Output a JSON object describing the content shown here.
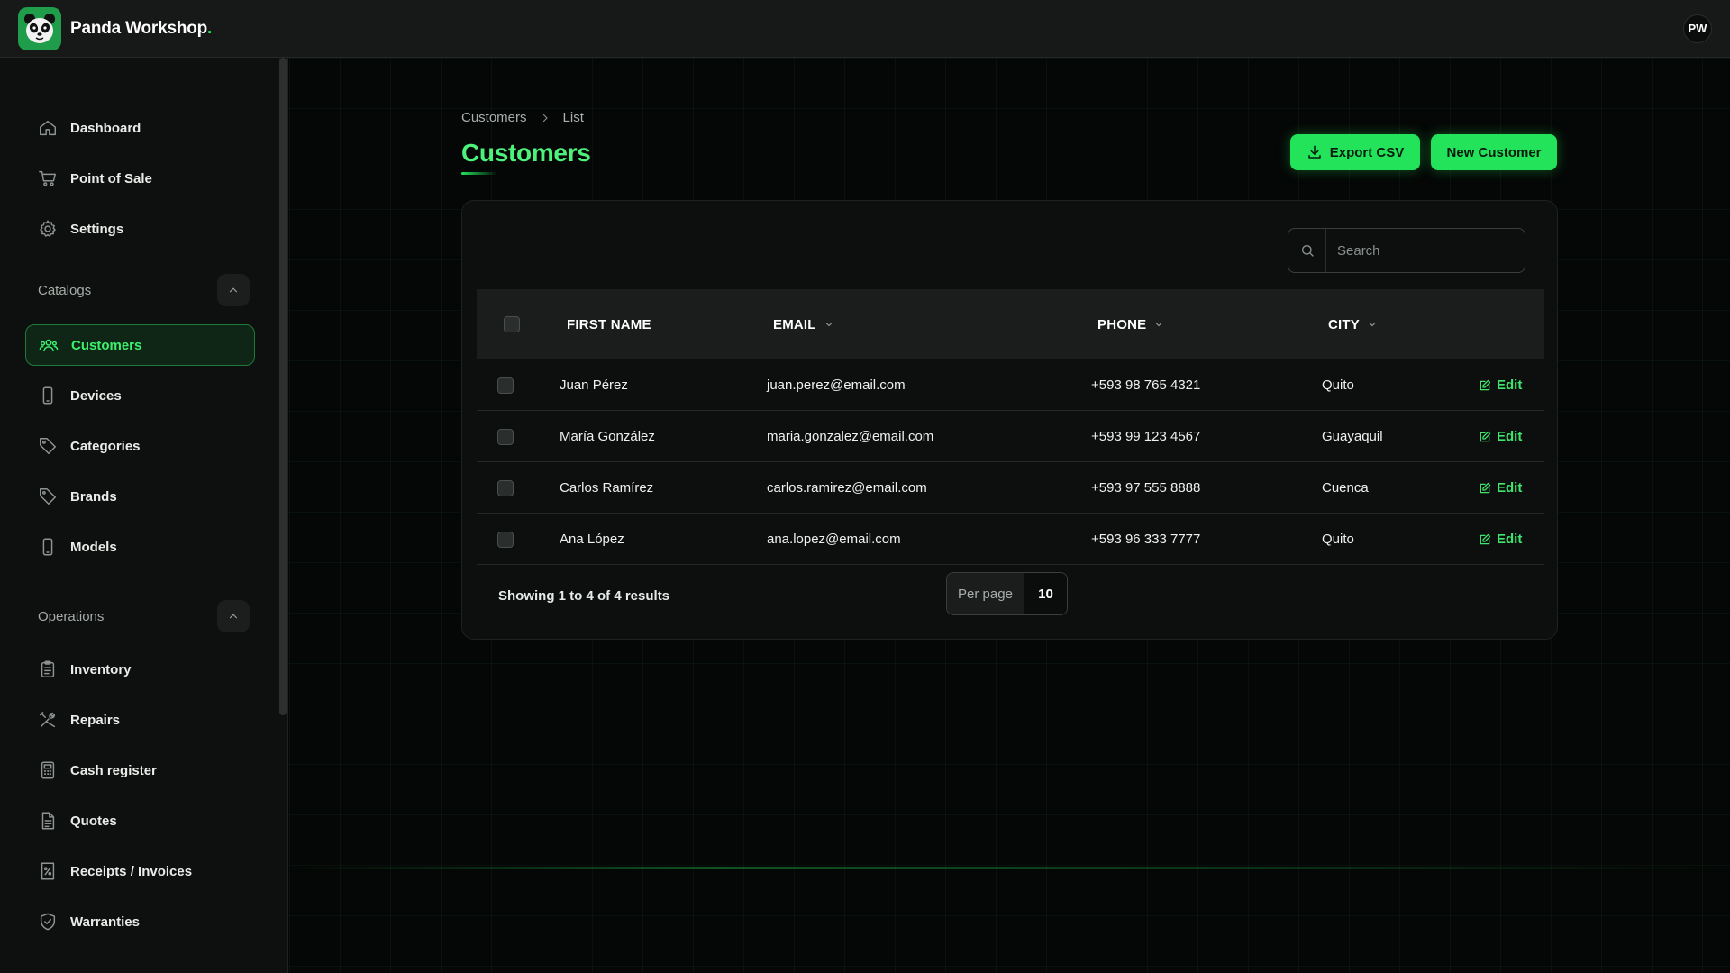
{
  "app": {
    "name": "Panda Workshop",
    "name_dot": ".",
    "user_initials": "PW"
  },
  "sidebar": {
    "top_items": [
      {
        "label": "Dashboard",
        "icon": "home-icon"
      },
      {
        "label": "Point of Sale",
        "icon": "cart-icon"
      },
      {
        "label": "Settings",
        "icon": "gear-icon"
      }
    ],
    "catalogs": {
      "label": "Catalogs",
      "items": [
        {
          "label": "Customers",
          "icon": "users-icon",
          "active": true
        },
        {
          "label": "Devices",
          "icon": "smartphone-icon"
        },
        {
          "label": "Categories",
          "icon": "tag-icon"
        },
        {
          "label": "Brands",
          "icon": "tag-icon"
        },
        {
          "label": "Models",
          "icon": "smartphone-icon"
        }
      ]
    },
    "operations": {
      "label": "Operations",
      "items": [
        {
          "label": "Inventory",
          "icon": "clipboard-icon"
        },
        {
          "label": "Repairs",
          "icon": "tools-icon"
        },
        {
          "label": "Cash register",
          "icon": "calculator-icon"
        },
        {
          "label": "Quotes",
          "icon": "document-icon"
        },
        {
          "label": "Receipts / Invoices",
          "icon": "receipt-icon"
        },
        {
          "label": "Warranties",
          "icon": "shield-check-icon"
        }
      ]
    }
  },
  "page": {
    "breadcrumb": [
      "Customers",
      "List"
    ],
    "title": "Customers",
    "export_label": "Export CSV",
    "new_label": "New Customer"
  },
  "search": {
    "placeholder": "Search"
  },
  "table": {
    "columns": [
      "FIRST NAME",
      "EMAIL",
      "PHONE",
      "CITY"
    ],
    "edit_label": "Edit",
    "rows": [
      {
        "first_name": "Juan Pérez",
        "email": "juan.perez@email.com",
        "phone": "+593 98 765 4321",
        "city": "Quito"
      },
      {
        "first_name": "María González",
        "email": "maria.gonzalez@email.com",
        "phone": "+593 99 123 4567",
        "city": "Guayaquil"
      },
      {
        "first_name": "Carlos Ramírez",
        "email": "carlos.ramirez@email.com",
        "phone": "+593 97 555 8888",
        "city": "Cuenca"
      },
      {
        "first_name": "Ana López",
        "email": "ana.lopez@email.com",
        "phone": "+593 96 333 7777",
        "city": "Quito"
      }
    ]
  },
  "pagination": {
    "summary": "Showing 1 to 4 of 4 results",
    "per_page_label": "Per page",
    "per_page_value": "10"
  },
  "colors": {
    "accent": "#22e35a",
    "background": "#050706",
    "sidebar": "#0e100f",
    "card": "#0d0f0e"
  }
}
